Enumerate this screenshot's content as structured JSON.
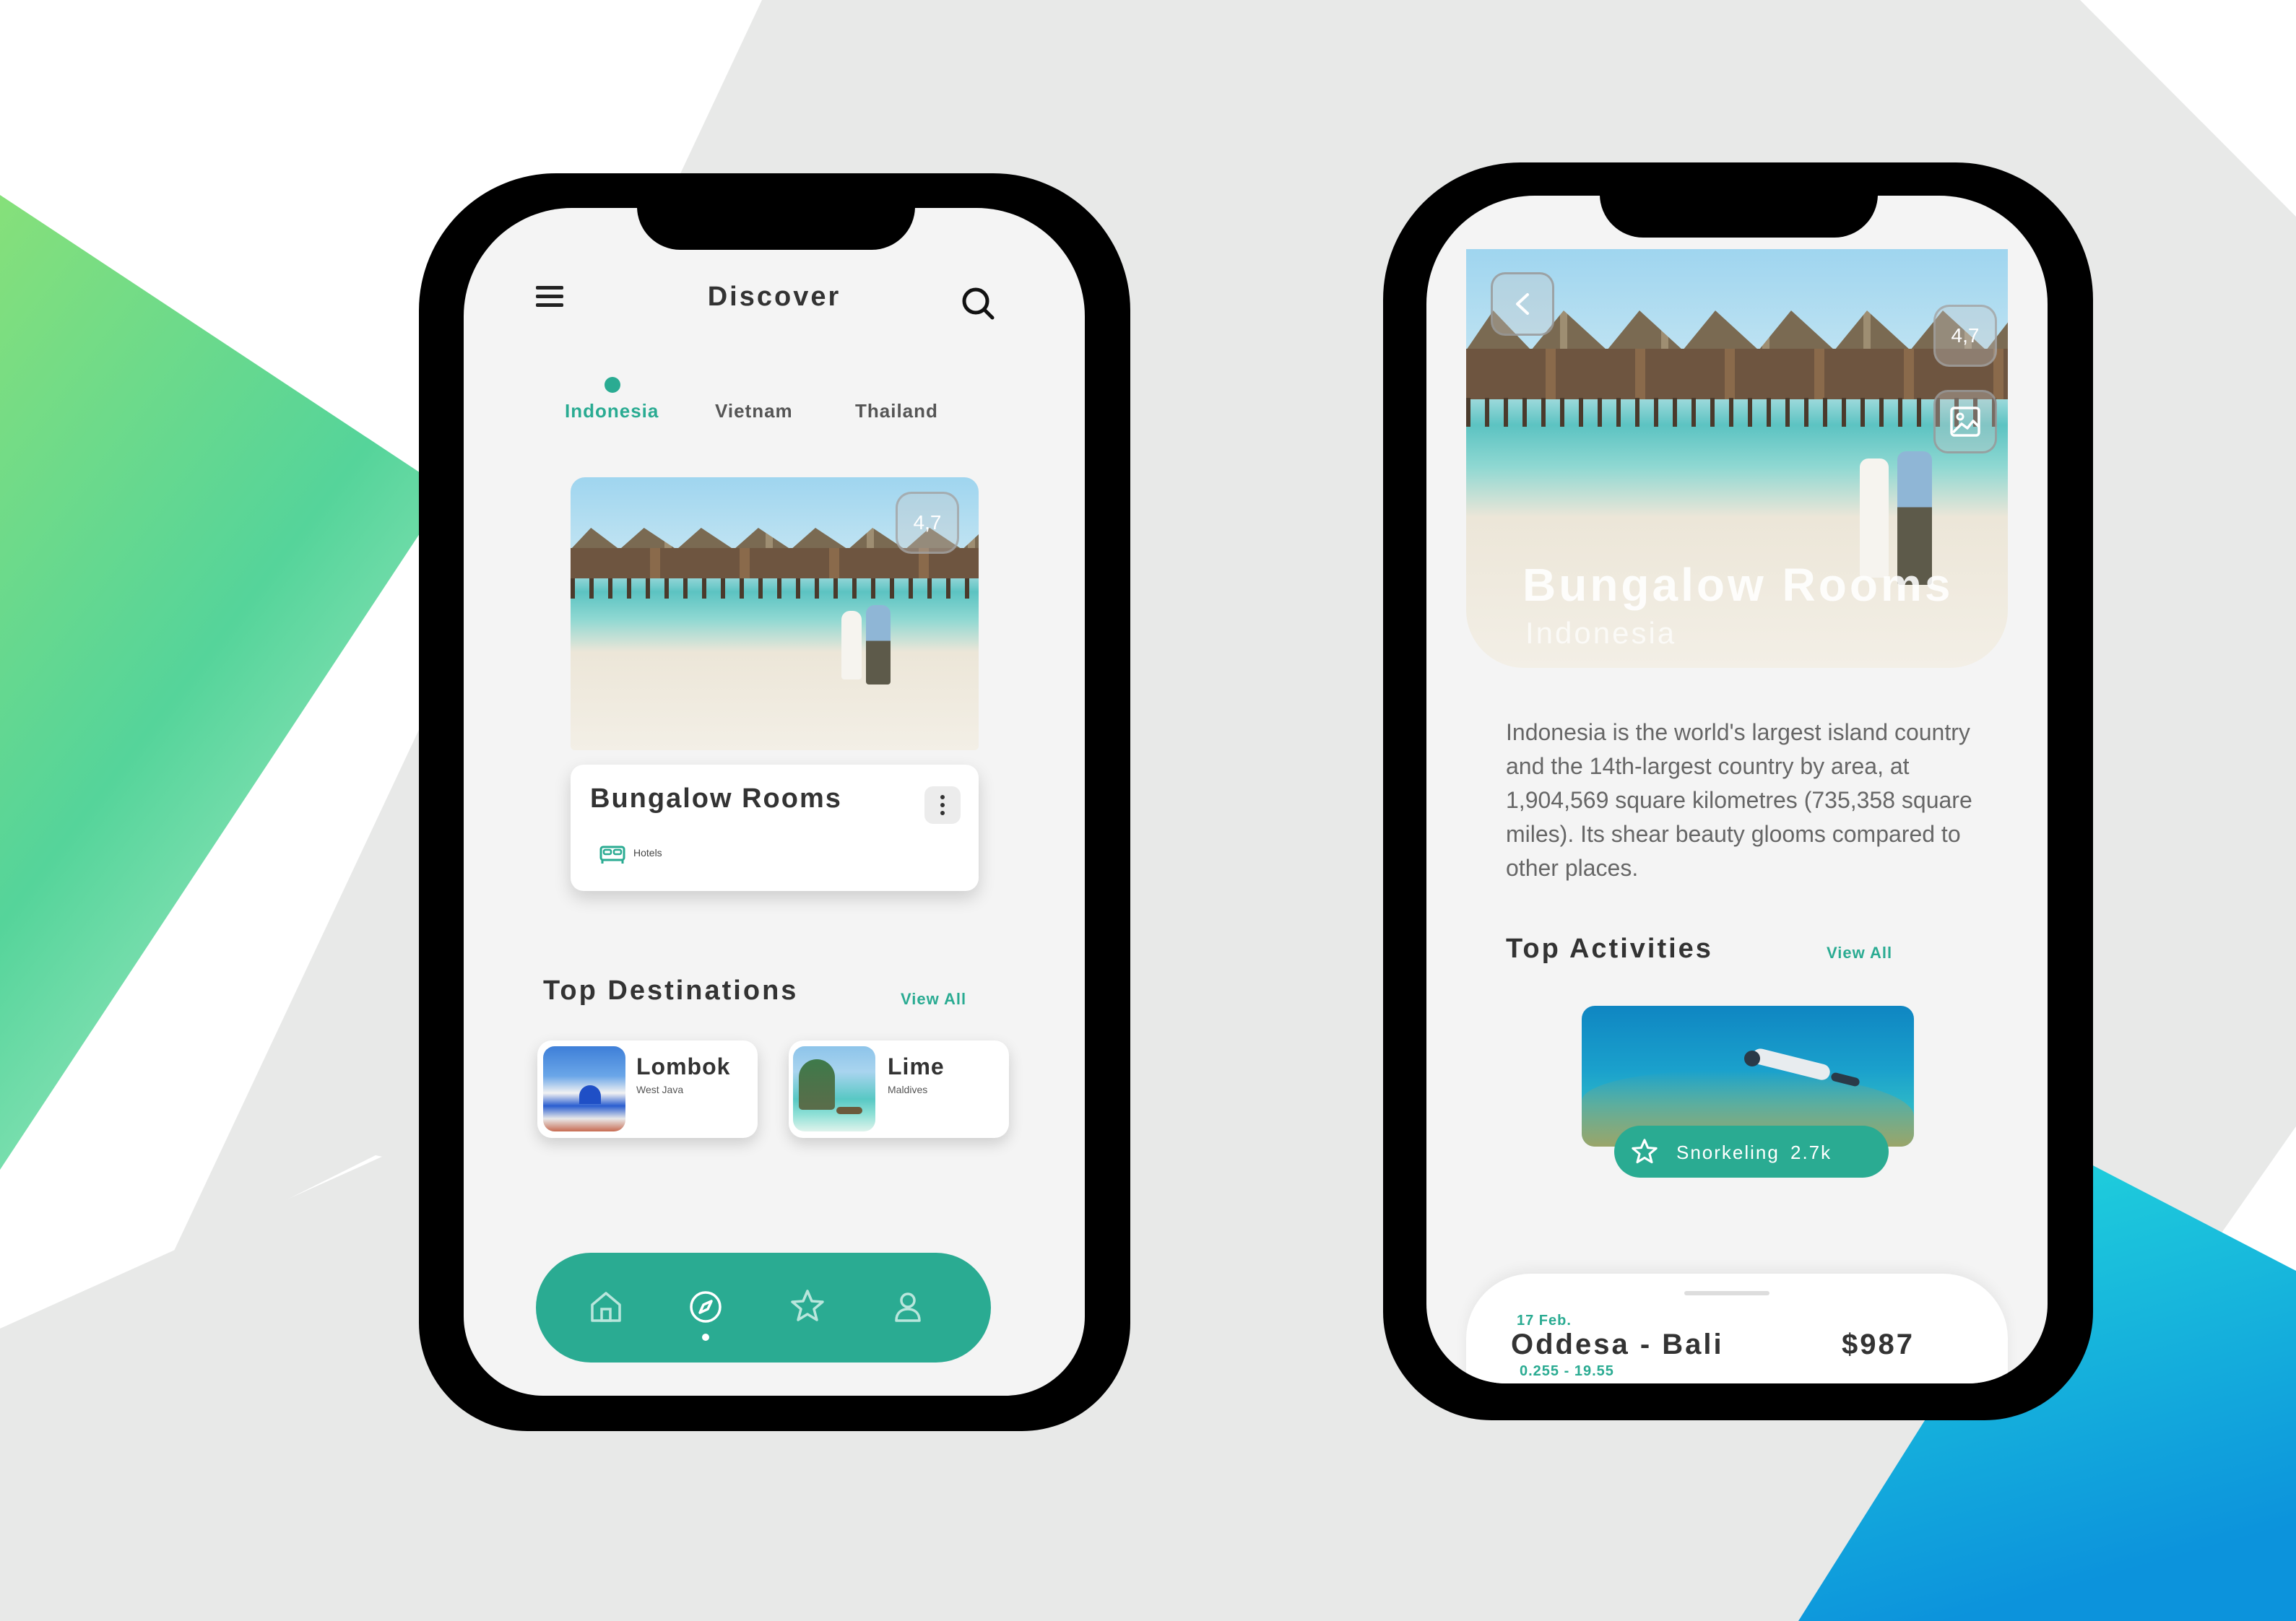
{
  "colors": {
    "accent": "#2aab92",
    "background_gray": "#e7e7e7",
    "green_start": "#8ee58a",
    "green_end": "#4ad1a8",
    "blue_start": "#20d4dc",
    "blue_end": "#0d98dc"
  },
  "discover": {
    "title": "Discover",
    "tabs": [
      {
        "label": "Indonesia",
        "active": true
      },
      {
        "label": "Vietnam",
        "active": false
      },
      {
        "label": "Thailand",
        "active": false
      }
    ],
    "featured": {
      "rating": "4,7",
      "title": "Bungalow Rooms",
      "category": "Hotels"
    },
    "top_destinations": {
      "title": "Top Destinations",
      "view_all": "View All",
      "items": [
        {
          "name": "Lombok",
          "subtitle": "West Java"
        },
        {
          "name": "Lime",
          "subtitle": "Maldives"
        }
      ]
    },
    "bottom_nav": [
      "home-icon",
      "compass-icon",
      "star-icon",
      "user-icon"
    ],
    "bottom_nav_active": "compass-icon"
  },
  "detail": {
    "rating": "4,7",
    "title": "Bungalow Rooms",
    "subtitle": "Indonesia",
    "description": "Indonesia is the world's largest island country and the 14th-largest country by area, at 1,904,569 square kilometres (735,358 square miles). Its shear beauty glooms compared to other places.",
    "top_activities": {
      "title": "Top Activities",
      "view_all": "View All",
      "activity": {
        "name": "Snorkeling",
        "count": "2.7k"
      }
    },
    "booking": {
      "date": "17 Feb.",
      "route": "Oddesa - Bali",
      "time": "0.255 - 19.55",
      "price": "$987"
    }
  }
}
